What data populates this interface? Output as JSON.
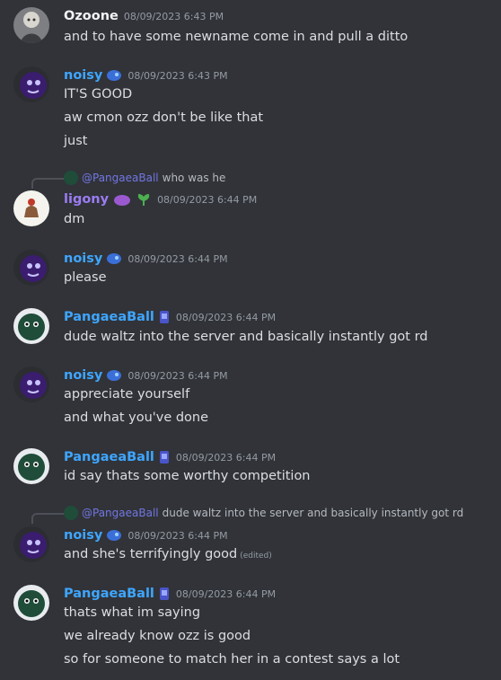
{
  "colors": {
    "ozoone": "#f2f3f5",
    "noisy": "#3ea6ff",
    "ligony": "#9b7cf2",
    "pangaea": "#3ea6ff"
  },
  "messages": [
    {
      "author": "Ozoone",
      "timestamp": "08/09/2023 6:43 PM",
      "lines": [
        "and to have some newname come in and pull a ditto"
      ]
    },
    {
      "author": "noisy",
      "timestamp": "08/09/2023 6:43 PM",
      "lines": [
        "IT'S GOOD",
        "aw cmon ozz don't be like that",
        "just"
      ]
    },
    {
      "author": "ligony",
      "timestamp": "08/09/2023 6:44 PM",
      "reply": {
        "name": "@PangaeaBall",
        "text": "who was he"
      },
      "lines": [
        "dm"
      ]
    },
    {
      "author": "noisy",
      "timestamp": "08/09/2023 6:44 PM",
      "lines": [
        "please"
      ]
    },
    {
      "author": "PangaeaBall",
      "timestamp": "08/09/2023 6:44 PM",
      "lines": [
        "dude waltz into the server and basically instantly got rd"
      ]
    },
    {
      "author": "noisy",
      "timestamp": "08/09/2023 6:44 PM",
      "lines": [
        "appreciate yourself",
        "and what you've done"
      ]
    },
    {
      "author": "PangaeaBall",
      "timestamp": "08/09/2023 6:44 PM",
      "lines": [
        "id say thats some worthy competition"
      ]
    },
    {
      "author": "noisy",
      "timestamp": "08/09/2023 6:44 PM",
      "reply": {
        "name": "@PangaeaBall",
        "text": "dude waltz into the server and basically instantly got rd"
      },
      "lines": [
        "and she's terrifyingly good"
      ],
      "edited": "(edited)"
    },
    {
      "author": "PangaeaBall",
      "timestamp": "08/09/2023 6:44 PM",
      "lines": [
        "thats what im saying",
        "we already know ozz is good",
        "so for someone to match her in a contest says a lot"
      ]
    }
  ]
}
